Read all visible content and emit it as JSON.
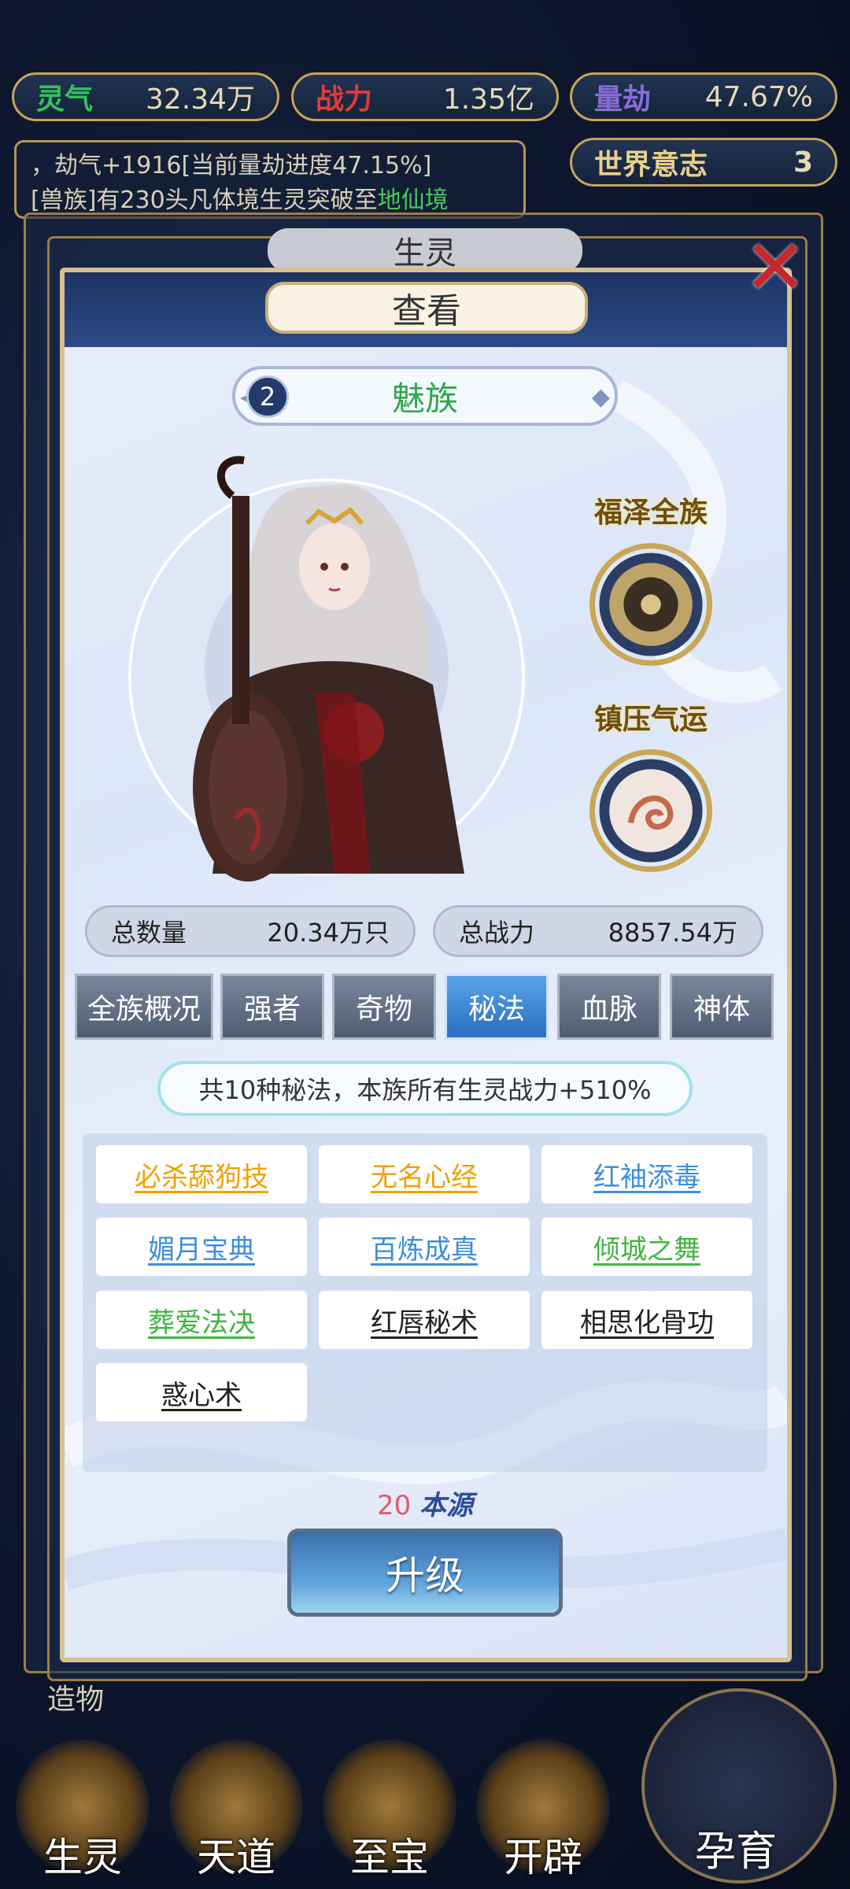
{
  "top_stats": [
    {
      "label": "灵气",
      "value": "32.34万",
      "color": "#2fc45a"
    },
    {
      "label": "战力",
      "value": "1.35亿",
      "color": "#e23a3a"
    },
    {
      "label": "量劫",
      "value": "47.67%",
      "color": "#8a6cd8"
    }
  ],
  "log": {
    "line1": "，劫气+1916[当前量劫进度47.15%]",
    "line2_prefix": "[兽族]有230头凡体境生灵突破至",
    "line2_highlight": "地仙境"
  },
  "world_will": {
    "label": "世界意志",
    "value": "3"
  },
  "bg_title": "生灵",
  "panel": {
    "title": "查看",
    "race_number": "2",
    "race_name": "魅族",
    "badge1_label": "福泽全族",
    "badge2_label": "镇压气运",
    "total_count_label": "总数量",
    "total_count_value": "20.34万只",
    "total_power_label": "总战力",
    "total_power_value": "8857.54万",
    "tabs": [
      "全族概况",
      "强者",
      "奇物",
      "秘法",
      "血脉",
      "神体"
    ],
    "active_tab": "秘法",
    "summary": "共10种秘法，本族所有生灵战力+510%",
    "skills": [
      {
        "name": "必杀舔狗技",
        "color": "#f0a000"
      },
      {
        "name": "无名心经",
        "color": "#f0a000"
      },
      {
        "name": "红袖添毒",
        "color": "#3d8de0"
      },
      {
        "name": "媚月宝典",
        "color": "#3d8de0"
      },
      {
        "name": "百炼成真",
        "color": "#3d8de0"
      },
      {
        "name": "倾城之舞",
        "color": "#3fb53f"
      },
      {
        "name": "葬爱法决",
        "color": "#3fb53f"
      },
      {
        "name": "红唇秘术",
        "color": "#222222"
      },
      {
        "name": "相思化骨功",
        "color": "#222222"
      },
      {
        "name": "惑心术",
        "color": "#222222"
      }
    ],
    "cost_number": "20",
    "cost_unit": "本源",
    "upgrade_label": "升级"
  },
  "bottom": {
    "creation_label": "造物",
    "nav": [
      "生灵",
      "天道",
      "至宝",
      "开辟"
    ],
    "breed_label": "孕育"
  },
  "icons": {
    "close": "close-x-icon",
    "badge1": "bagua-medallion-icon",
    "badge2": "phoenix-medallion-icon"
  }
}
